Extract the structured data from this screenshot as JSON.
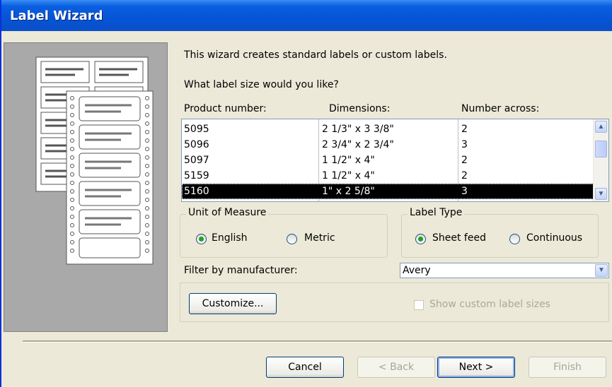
{
  "window": {
    "title": "Label Wizard"
  },
  "intro": {
    "line1": "This wizard creates standard labels or custom labels.",
    "line2": "What label size would you like?"
  },
  "list": {
    "headers": {
      "product": "Product number:",
      "dimensions": "Dimensions:",
      "across": "Number across:"
    },
    "rows": [
      {
        "product": "5095",
        "dimensions": "2 1/3\" x 3 3/8\"",
        "across": "2"
      },
      {
        "product": "5096",
        "dimensions": "2 3/4\" x 2 3/4\"",
        "across": "3"
      },
      {
        "product": "5097",
        "dimensions": "1 1/2\" x 4\"",
        "across": "2"
      },
      {
        "product": "5159",
        "dimensions": "1 1/2\" x 4\"",
        "across": "2"
      },
      {
        "product": "5160",
        "dimensions": "1\" x 2 5/8\"",
        "across": "3"
      }
    ]
  },
  "unit_group": {
    "title": "Unit of Measure",
    "english": "English",
    "metric": "Metric"
  },
  "type_group": {
    "title": "Label Type",
    "sheet": "Sheet feed",
    "continuous": "Continuous"
  },
  "filter": {
    "label": "Filter by  manufacturer:",
    "value": "Avery"
  },
  "customize": {
    "button": "Customize...",
    "checkbox_label": "Show custom label sizes"
  },
  "buttons": {
    "cancel": "Cancel",
    "back": "< Back",
    "next": "Next >",
    "finish": "Finish"
  },
  "colors": {
    "titlebar": "#0a5fe0",
    "selection": "#000000",
    "radio_dot": "#21a121"
  }
}
